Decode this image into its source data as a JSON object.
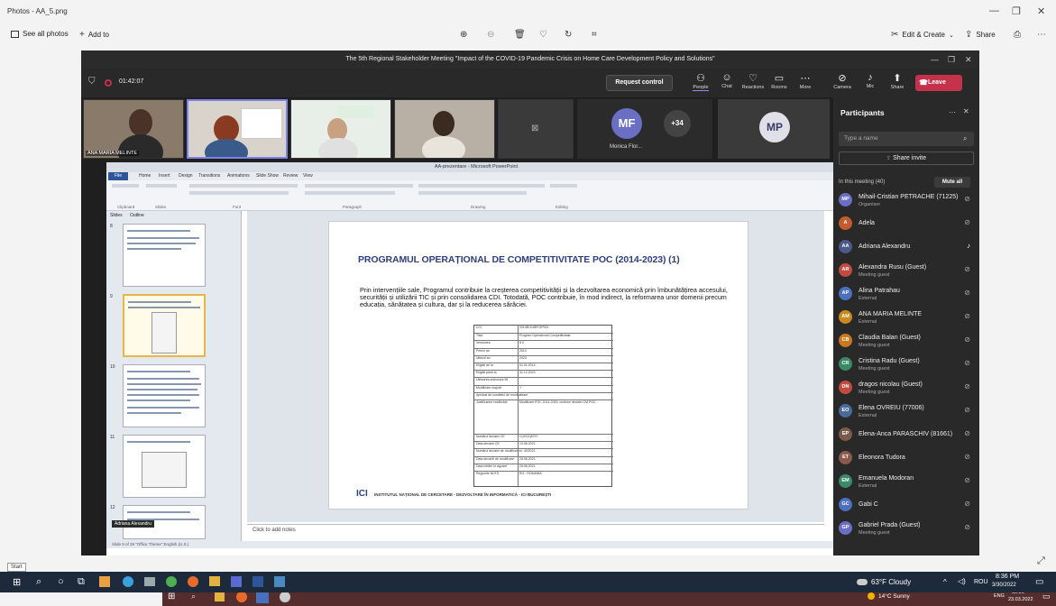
{
  "app": {
    "title": "Photos - AA_5.png",
    "see_all": "See all photos",
    "add_to": "Add to",
    "edit_create": "Edit & Create",
    "share": "Share"
  },
  "meeting": {
    "title": "The 5th Regional Stakeholder Meeting \"Impact of the COVID-19 Pandemic Crisis on Home Care Development Policy and Solutions\"",
    "timer": "01:42:07",
    "request_control": "Request control",
    "controls": [
      "People",
      "Chat",
      "Reactions",
      "Rooms",
      "More",
      "Camera",
      "Mic",
      "Share"
    ],
    "leave": "Leave",
    "tile_labels": [
      "ANA MARIA MELINTE",
      "Monica Flor..."
    ],
    "avatar_mf": "MF",
    "plus_count": "+34",
    "avatar_mp": "MP"
  },
  "participants": {
    "title": "Participants",
    "search_placeholder": "Type a name",
    "share_invite": "Share invite",
    "in_meeting": "In this meeting (40)",
    "mute_all": "Mute all",
    "list": [
      {
        "initials": "MP",
        "name": "Mihail-Cristian PETRACHE (71225)",
        "sub": "Organiser",
        "color": "#6b6fc4"
      },
      {
        "initials": "A",
        "name": "Adela",
        "sub": "",
        "color": "#c25c2f"
      },
      {
        "initials": "AA",
        "name": "Adriana Alexandru",
        "sub": "",
        "color": "#4a5a8a"
      },
      {
        "initials": "AR",
        "name": "Alexandra Rusu (Guest)",
        "sub": "Meeting guest",
        "color": "#c24b40"
      },
      {
        "initials": "AP",
        "name": "Alina Patrahau",
        "sub": "External",
        "color": "#4d6fbf"
      },
      {
        "initials": "AM",
        "name": "ANA MARIA MELINTE",
        "sub": "External",
        "color": "#c98a1e"
      },
      {
        "initials": "CB",
        "name": "Claudia Balan (Guest)",
        "sub": "Meeting guest",
        "color": "#c97a1e"
      },
      {
        "initials": "CR",
        "name": "Cristina Radu (Guest)",
        "sub": "Meeting guest",
        "color": "#3a8a6a"
      },
      {
        "initials": "DN",
        "name": "dragos nicolau (Guest)",
        "sub": "Meeting guest",
        "color": "#c24b40"
      },
      {
        "initials": "EO",
        "name": "Elena OVREIU (77006)",
        "sub": "External",
        "color": "#4a6a9a"
      },
      {
        "initials": "EP",
        "name": "Elena-Anca PARASCHIV (81661)",
        "sub": "",
        "color": "#7a5a4a"
      },
      {
        "initials": "ET",
        "name": "Eleonora Tudora",
        "sub": "",
        "color": "#8a5a4a"
      },
      {
        "initials": "EM",
        "name": "Emanuela Modoran",
        "sub": "External",
        "color": "#3a8a6a"
      },
      {
        "initials": "GC",
        "name": "Gabi C",
        "sub": "",
        "color": "#4d6fbf"
      },
      {
        "initials": "GP",
        "name": "Gabriel Prada (Guest)",
        "sub": "Meeting guest",
        "color": "#6b6fc4"
      }
    ]
  },
  "ppt": {
    "window_title": "AA-prezentare - Microsoft PowerPoint",
    "file_tab": "File",
    "tabs": [
      "Home",
      "Insert",
      "Design",
      "Transitions",
      "Animations",
      "Slide Show",
      "Review",
      "View"
    ],
    "groups": [
      "Clipboard",
      "Slides",
      "Font",
      "Paragraph",
      "Drawing",
      "Editing"
    ],
    "pane_tabs": [
      "Slides",
      "Outline"
    ],
    "slide_numbers": [
      "8",
      "9",
      "10",
      "11",
      "12"
    ],
    "slide_title": "PROGRAMUL OPERAȚIONAL DE COMPETITIVITATE POC (2014-2023) (1)",
    "slide_body": "Prin intervențiile sale, Programul contribuie la creșterea competitivității și la dezvoltarea economică prin îmbunătățirea accesului, securității și utilizării TIC și prin consolidarea CDI. Totodată, POC contribuie, în mod indirect, la reformarea unor domenii precum educația, sănătatea și cultura, dar și la reducerea sărăciei.",
    "table_rows": [
      [
        "CCI",
        "2014RO16RFOP001"
      ],
      [
        "Titlul",
        "Program Operațional Competitivitate"
      ],
      [
        "Versiunea",
        "8.0"
      ],
      [
        "Primul an",
        "2014"
      ],
      [
        "Ultimul an",
        "2020"
      ],
      [
        "Eligibil de la",
        "01.01.2014"
      ],
      [
        "Eligibil până la",
        "31.12.2023"
      ],
      [
        "Utilizarea articolului 96",
        ""
      ],
      [
        "Modificare majoră",
        "✓"
      ],
      [
        "Aprobat de comitetul de monitorizare",
        "✓"
      ],
      [
        "Justificarea modificării",
        "Modificare POC 2014-2020, conform deciziei CM POC..."
      ],
      [
        "Numărul deciziei CE",
        "C(2021)8797"
      ],
      [
        "Data deciziei CE",
        "10.08.2021"
      ],
      [
        "Numărul deciziei de modificare",
        "nr. 40/2021"
      ],
      [
        "Data deciziei de modificare",
        "26.08.2021"
      ],
      [
        "Data intrării în vigoare",
        "26.08.2021"
      ],
      [
        "Regiunile NUTS",
        "RO - ROMANIA"
      ]
    ],
    "footer": "INSTITUTUL NAȚIONAL DE CERCETARE - DEZVOLTARE ÎN INFORMATICĂ - ICI BUCUREȘTI",
    "notes_placeholder": "Click to add notes",
    "status": "Slide 9 of 29   \"Office Theme\"   English (U.S.)",
    "tooltip": "Adriana Alexandru"
  },
  "inner_taskbar": {
    "weather": "14°C Sunny",
    "lang": "ENG",
    "time": "13:30",
    "date": "23.03.2022"
  },
  "taskbar": {
    "start_tip": "Start",
    "weather": "63°F Cloudy",
    "lang": "ROU",
    "time": "8:36 PM",
    "date": "3/30/2022"
  }
}
